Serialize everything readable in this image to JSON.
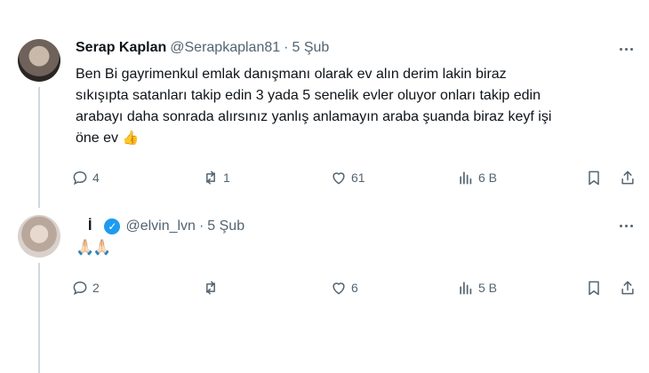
{
  "tweets": [
    {
      "name": "Serap Kaplan",
      "handle": "@Serapkaplan81",
      "dot": "·",
      "date": "5 Şub",
      "body_lines": [
        "Ben Bi gayrimenkul emlak danışmanı olarak ev alın derim lakin biraz",
        "sıkışıpta satanları takip edin 3 yada 5 senelik evler oluyor onları takip edin",
        "arabayı daha sonrada alırsınız yanlış anlamayın araba şuanda biraz keyf işi",
        "öne ev"
      ],
      "emoji": "👍",
      "actions": {
        "reply": "4",
        "retweet": "1",
        "like": "61",
        "views": "6 B"
      }
    },
    {
      "name": "İ",
      "handle": "@elvin_lvn",
      "dot": "·",
      "date": "5 Şub",
      "body": "🙏🏻🙏🏻",
      "actions": {
        "reply": "2",
        "retweet": "",
        "like": "6",
        "views": "5 B"
      }
    }
  ],
  "icons": [
    "more-icon",
    "reply-icon",
    "retweet-icon",
    "like-icon",
    "views-icon",
    "bookmark-icon",
    "share-icon",
    "verified-badge-icon"
  ],
  "colors": {
    "text": "#0f1419",
    "secondary": "#536471",
    "verified": "#1d9bf0",
    "thread_line": "#cfd9de"
  }
}
